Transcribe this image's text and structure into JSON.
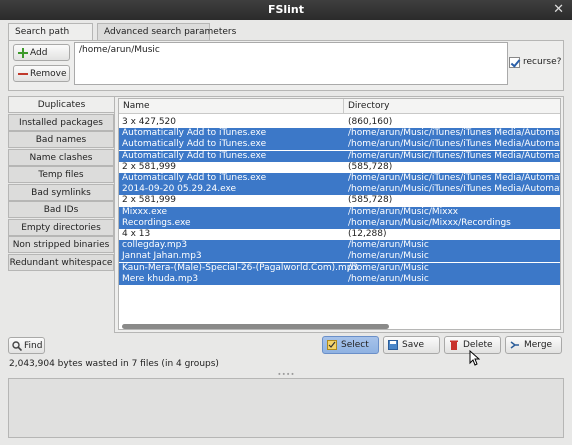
{
  "window": {
    "title": "FSlint",
    "close_glyph": "✕"
  },
  "tabs": [
    {
      "label": "Search path",
      "active": true
    },
    {
      "label": "Advanced search parameters",
      "active": false
    }
  ],
  "search": {
    "add_label": "Add",
    "remove_label": "Remove",
    "path": "/home/arun/Music",
    "recurse_label": "recurse?",
    "recurse_checked": true
  },
  "sidebar": {
    "items": [
      {
        "label": "Duplicates",
        "active": true
      },
      {
        "label": "Installed packages"
      },
      {
        "label": "Bad names"
      },
      {
        "label": "Name clashes"
      },
      {
        "label": "Temp files"
      },
      {
        "label": "Bad symlinks"
      },
      {
        "label": "Bad IDs"
      },
      {
        "label": "Empty directories"
      },
      {
        "label": "Non stripped binaries"
      },
      {
        "label": "Redundant whitespace"
      }
    ]
  },
  "results": {
    "columns": [
      "Name",
      "Directory"
    ],
    "rows": [
      {
        "name": "3 x 427,520",
        "dir": "(860,160)",
        "selected": false
      },
      {
        "name": "Automatically Add to iTunes.exe",
        "dir": "/home/arun/Music/iTunes/iTunes Media/Automatical",
        "selected": true
      },
      {
        "name": "Automatically Add to iTunes.exe",
        "dir": "/home/arun/Music/iTunes/iTunes Media/Automatical",
        "selected": true
      },
      {
        "name": "Automatically Add to iTunes.exe",
        "dir": "/home/arun/Music/iTunes/iTunes Media/Automatical",
        "selected": true
      },
      {
        "name": "2 x 581,999",
        "dir": "(585,728)",
        "selected": false
      },
      {
        "name": "Automatically Add to iTunes.exe",
        "dir": "/home/arun/Music/iTunes/iTunes Media/Automatical",
        "selected": true
      },
      {
        "name": "2014-09-20 05.29.24.exe",
        "dir": "/home/arun/Music/iTunes/iTunes Media/Automatical",
        "selected": true
      },
      {
        "name": "2 x 581,999",
        "dir": "(585,728)",
        "selected": false
      },
      {
        "name": "Mixxx.exe",
        "dir": "/home/arun/Music/Mixxx",
        "selected": true
      },
      {
        "name": "Recordings.exe",
        "dir": "/home/arun/Music/Mixxx/Recordings",
        "selected": true
      },
      {
        "name": "4 x 13",
        "dir": "(12,288)",
        "selected": false
      },
      {
        "name": "collegday.mp3",
        "dir": "/home/arun/Music",
        "selected": true
      },
      {
        "name": "Jannat Jahan.mp3",
        "dir": "/home/arun/Music",
        "selected": true
      },
      {
        "name": "Kaun-Mera-(Male)-Special-26-(Pagalworld.Com).mp3",
        "dir": "/home/arun/Music",
        "selected": true
      },
      {
        "name": "Mere khuda.mp3",
        "dir": "/home/arun/Music",
        "selected": true
      }
    ]
  },
  "actions": {
    "find_label": "Find",
    "select_label": "Select",
    "save_label": "Save",
    "delete_label": "Delete",
    "merge_label": "Merge"
  },
  "status": "2,043,904 bytes wasted in 7 files (in 4 groups)",
  "colors": {
    "selection": "#3c78c8",
    "titlebar": "#333333"
  }
}
